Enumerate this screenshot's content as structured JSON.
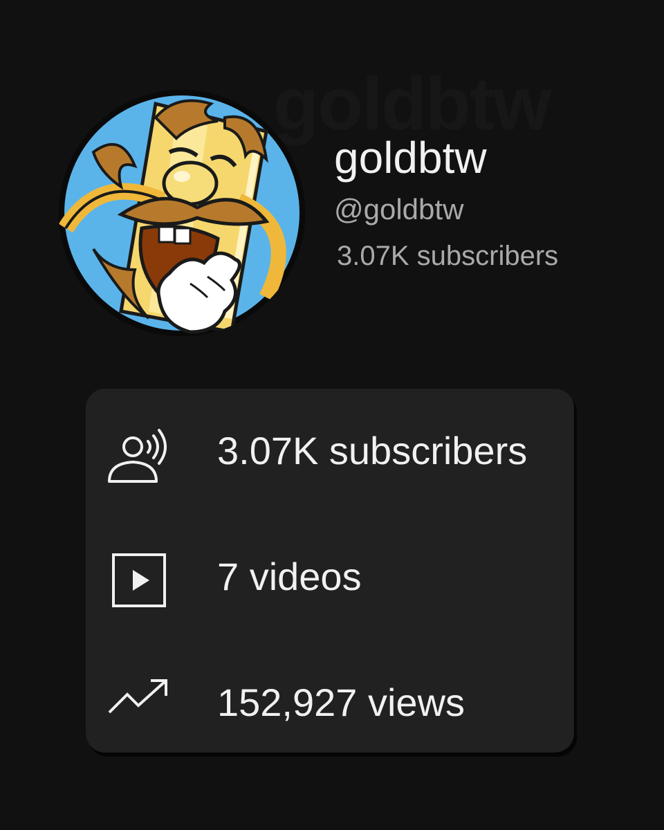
{
  "channel": {
    "name": "goldbtw",
    "handle": "@goldbtw",
    "subscribers_short": "3.07K subscribers",
    "watermark": "goldbtw"
  },
  "stats": {
    "subscribers": {
      "icon": "subscribers-broadcast-icon",
      "text": "3.07K subscribers"
    },
    "videos": {
      "icon": "play-square-icon",
      "text": "7 videos"
    },
    "views": {
      "icon": "trending-up-icon",
      "text": "152,927 views"
    }
  },
  "colors": {
    "background": "#111111",
    "card": "#212121",
    "primary_text": "#f1f1f1",
    "secondary_text": "#aaaaaa",
    "avatar_sky": "#5ab4ea",
    "avatar_gold": "#f5d76e",
    "avatar_hair": "#b77a2c"
  }
}
